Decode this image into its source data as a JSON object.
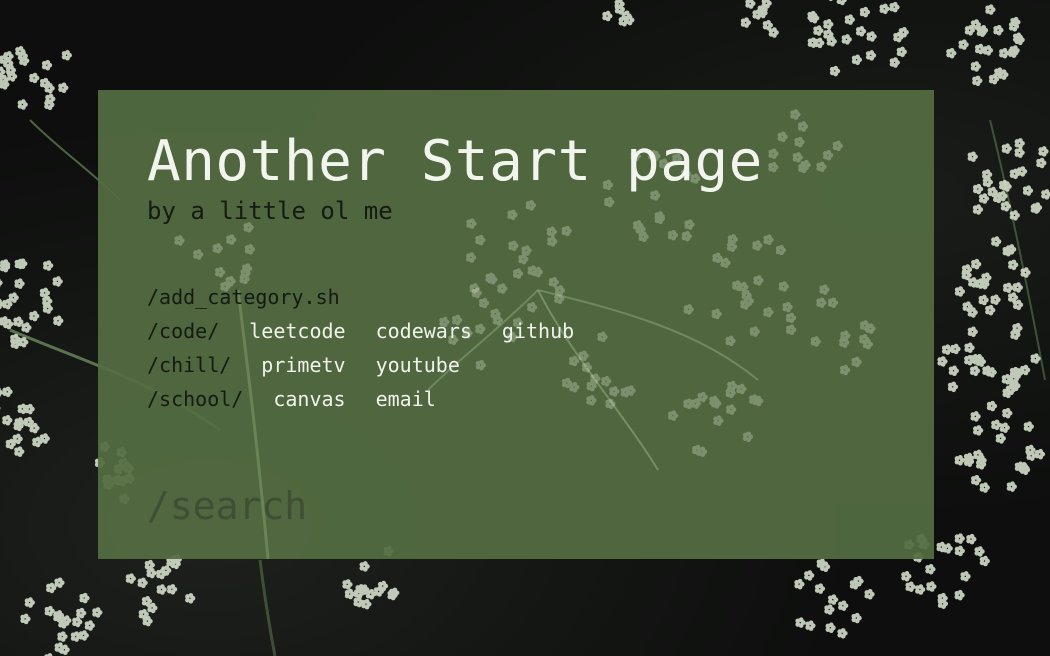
{
  "page": {
    "title": "Another Start page",
    "subtitle": "by a little ol me"
  },
  "menu": {
    "add_category": "/add_category.sh",
    "categories": [
      {
        "name": "/code/",
        "links": [
          "leetcode",
          "codewars",
          "github"
        ]
      },
      {
        "name": "/chill/",
        "links": [
          "primetv",
          "youtube"
        ]
      },
      {
        "name": "/school/",
        "links": [
          "canvas",
          "email"
        ]
      }
    ]
  },
  "search": {
    "placeholder": "/search",
    "value": ""
  },
  "colors": {
    "panel": "#546d42",
    "background": "#0d0e0d",
    "light_text": "#f2f5ee",
    "dark_text": "#151a12",
    "flowers": "#dfe8d4"
  },
  "background": {
    "image": "dark botanical photo of cow parsley / flower clusters"
  }
}
